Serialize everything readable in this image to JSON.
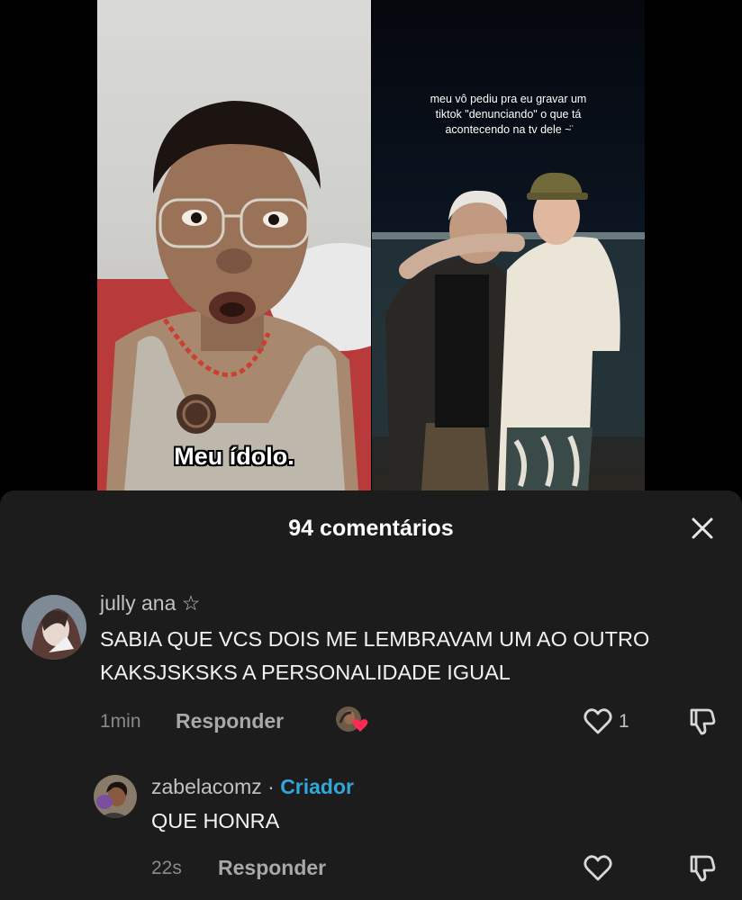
{
  "video": {
    "left_subtitle": "Meu ídolo.",
    "right_caption": "meu vô pediu pra eu gravar um\ntiktok \"denunciando\" o que tá\nacontecendo na tv dele ~̈"
  },
  "comments_sheet": {
    "title": "94 comentários",
    "close_icon": "close-icon"
  },
  "comments": [
    {
      "username": "jully ana ☆",
      "text_lines": [
        "SABIA QUE VCS DOIS ME LEMBRAVAM UM AO OUTRO",
        "KAKSJSKSKS A PERSONALIDADE IGUAL"
      ],
      "time": "1min",
      "reply_label": "Responder",
      "like_count": "1",
      "creator_liked": true
    },
    {
      "username": "zabelacomz",
      "separator": "·",
      "badge": "Criador",
      "text_lines": [
        "QUE HONRA"
      ],
      "time": "22s",
      "reply_label": "Responder",
      "like_count": ""
    }
  ],
  "colors": {
    "sheet_bg": "#1c1c1c",
    "creator_badge": "#2fa8d9",
    "heart_badge": "#fe2c55"
  }
}
